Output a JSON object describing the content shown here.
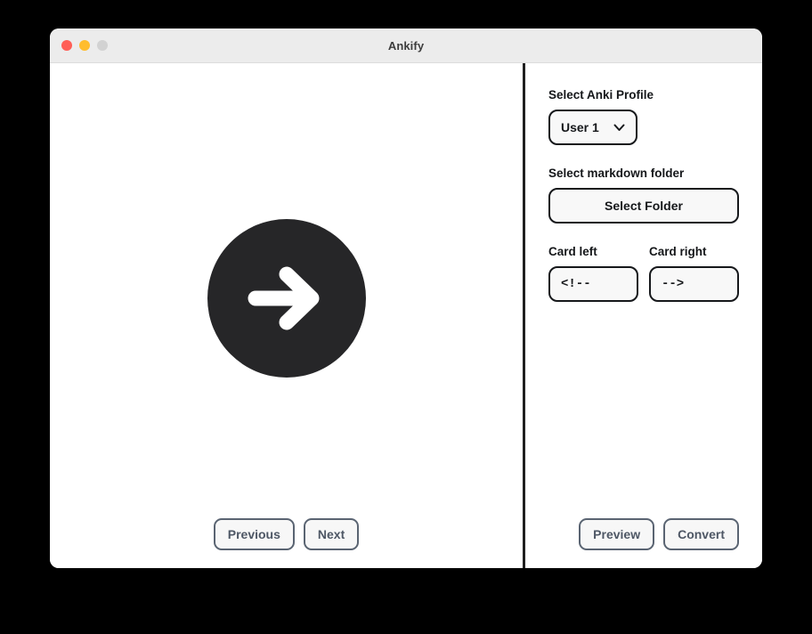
{
  "window": {
    "title": "Ankify",
    "traffic_lights": [
      {
        "name": "close",
        "color": "#ff5f57"
      },
      {
        "name": "minimize",
        "color": "#ffbd2e"
      },
      {
        "name": "maximize",
        "color": "#d2d2d2"
      }
    ]
  },
  "preview": {
    "icon": "arrow-right-circle-icon",
    "badge_color": "#262628",
    "arrow_color": "#ffffff"
  },
  "left_actions": {
    "previous_label": "Previous",
    "next_label": "Next"
  },
  "settings": {
    "profile": {
      "label": "Select Anki Profile",
      "value": "User 1",
      "chevron_icon": "chevron-down-icon"
    },
    "folder": {
      "label": "Select markdown folder",
      "button_label": "Select Folder"
    },
    "card_left": {
      "label": "Card left",
      "value": "<!--",
      "placeholder": "<!--"
    },
    "card_right": {
      "label": "Card right",
      "value": "-->",
      "placeholder": "-->"
    }
  },
  "right_actions": {
    "preview_label": "Preview",
    "convert_label": "Convert"
  },
  "colors": {
    "titlebar": "#ececec",
    "accent_border": "#16181b",
    "pill_border": "#5a6472",
    "divider": "#1f1f1f"
  }
}
